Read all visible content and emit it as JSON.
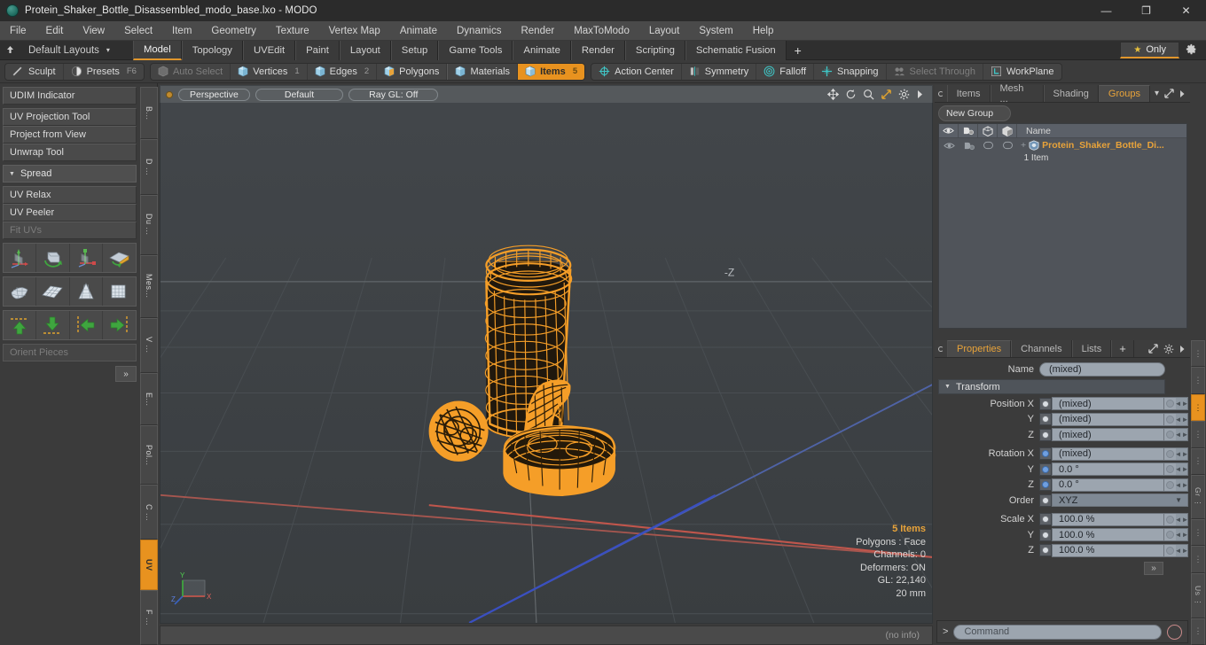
{
  "window": {
    "title": "Protein_Shaker_Bottle_Disassembled_modo_base.lxo - MODO",
    "minimize": "—",
    "maximize": "❐",
    "close": "✕"
  },
  "menubar": [
    "File",
    "Edit",
    "View",
    "Select",
    "Item",
    "Geometry",
    "Texture",
    "Vertex Map",
    "Animate",
    "Dynamics",
    "Render",
    "MaxToModo",
    "Layout",
    "System",
    "Help"
  ],
  "layoutbar": {
    "default_layouts": "Default Layouts",
    "caret": "▾",
    "tabs": [
      {
        "label": "Model",
        "active": true
      },
      {
        "label": "Topology",
        "active": false
      },
      {
        "label": "UVEdit",
        "active": false
      },
      {
        "label": "Paint",
        "active": false
      },
      {
        "label": "Layout",
        "active": false
      },
      {
        "label": "Setup",
        "active": false
      },
      {
        "label": "Game Tools",
        "active": false
      },
      {
        "label": "Animate",
        "active": false
      },
      {
        "label": "Render",
        "active": false
      },
      {
        "label": "Scripting",
        "active": false
      },
      {
        "label": "Schematic Fusion",
        "active": false
      }
    ],
    "plus": "+",
    "only": "Only",
    "accent": "#e0962c"
  },
  "modebar": {
    "left_group": [
      {
        "label": "Sculpt",
        "icon": "sculpt-icon",
        "shortcut": ""
      },
      {
        "label": "Presets",
        "icon": "presets-icon",
        "shortcut": "F6"
      }
    ],
    "select_group": [
      {
        "label": "Auto Select",
        "count": "",
        "state": "dim"
      },
      {
        "label": "Vertices",
        "count": "1",
        "state": "normal"
      },
      {
        "label": "Edges",
        "count": "2",
        "state": "normal"
      },
      {
        "label": "Polygons",
        "count": "",
        "state": "normal"
      },
      {
        "label": "Materials",
        "count": "",
        "state": "normal"
      },
      {
        "label": "Items",
        "count": "5",
        "state": "selected"
      }
    ],
    "tool_group": [
      {
        "label": "Action Center",
        "state": "normal"
      },
      {
        "label": "Symmetry",
        "state": "normal"
      },
      {
        "label": "Falloff",
        "state": "normal"
      },
      {
        "label": "Snapping",
        "state": "normal"
      },
      {
        "label": "Select Through",
        "state": "dim"
      },
      {
        "label": "WorkPlane",
        "state": "normal"
      }
    ]
  },
  "left_panel": {
    "buttons_top": [
      "UDIM Indicator"
    ],
    "buttons_group2": [
      "UV Projection Tool",
      "Project from View",
      "Unwrap Tool"
    ],
    "section": {
      "label": "Spread",
      "tri": "▼"
    },
    "buttons_group3": [
      {
        "label": "UV Relax",
        "dim": false
      },
      {
        "label": "UV Peeler",
        "dim": false
      },
      {
        "label": "Fit UVs",
        "dim": true
      }
    ],
    "icon_rows": [
      [
        "move-axis-icon",
        "rotate-cube-icon",
        "scale-axis-icon",
        "flatten-icon"
      ],
      [
        "sphere-uv-icon",
        "grid-uv-icon",
        "cone-uv-icon",
        "box-uv-icon"
      ],
      [
        "align-up-icon",
        "align-down-icon",
        "align-left-icon",
        "align-right-icon"
      ]
    ],
    "orient_pieces": "Orient Pieces",
    "expand": "»",
    "vtabs": [
      {
        "label": "B...",
        "on": false
      },
      {
        "label": "D ...",
        "on": false
      },
      {
        "label": "Du ...",
        "on": false
      },
      {
        "label": "Mes...",
        "on": false
      },
      {
        "label": "V ...",
        "on": false
      },
      {
        "label": "E...",
        "on": false
      },
      {
        "label": "Pol...",
        "on": false
      },
      {
        "label": "C ...",
        "on": false
      },
      {
        "label": "UV",
        "on": true
      },
      {
        "label": "F ...",
        "on": false
      }
    ]
  },
  "viewport": {
    "header": {
      "perspective": "Perspective",
      "shading": "Default",
      "raygl": "Ray GL: Off",
      "icons": [
        "pan-icon",
        "rotate-icon",
        "zoom-icon",
        "fit-icon",
        "gear-icon",
        "chevron-right-icon"
      ]
    },
    "axis_label_minus_z": "-Z",
    "stats": {
      "items": "5 Items",
      "polygons": "Polygons : Face",
      "channels": "Channels: 0",
      "deformers": "Deformers: ON",
      "gl": "GL: 22,140",
      "scale": "20 mm"
    },
    "axis_gizmo": {
      "x": "X",
      "y": "Y",
      "z": "Z"
    },
    "model_color": "#f59e28",
    "bg_color": "#3e4245"
  },
  "info_bar": {
    "text": "(no info)"
  },
  "right_panel": {
    "top_tabs": [
      {
        "label": "Items",
        "active": false
      },
      {
        "label": "Mesh ...",
        "active": false
      },
      {
        "label": "Shading",
        "active": false
      },
      {
        "label": "Groups",
        "active": true
      }
    ],
    "top_tabs_caret": "▾",
    "new_group": "New Group",
    "list_header": {
      "col_icons": [
        "eye-icon",
        "render-icon",
        "wire-icon",
        "shade-icon"
      ],
      "name": "Name"
    },
    "list_rows": [
      {
        "name": "Protein_Shaker_Bottle_Di...",
        "sub": "1 Item",
        "plus": "+"
      }
    ],
    "prop_tabs": [
      {
        "label": "Properties",
        "active": true
      },
      {
        "label": "Channels",
        "active": false
      },
      {
        "label": "Lists",
        "active": false
      },
      {
        "label": "+",
        "active": false
      }
    ],
    "properties": {
      "name_label": "Name",
      "name_value": "(mixed)",
      "transform_label": "Transform",
      "transform_tri": "▼",
      "rows": [
        {
          "label": "Position X",
          "value": "(mixed)",
          "dot": "white"
        },
        {
          "label": "Y",
          "value": "(mixed)",
          "dot": "white"
        },
        {
          "label": "Z",
          "value": "(mixed)",
          "dot": "white"
        },
        {
          "label": "Rotation X",
          "value": "(mixed)",
          "dot": "blue"
        },
        {
          "label": "Y",
          "value": "0.0 °",
          "dot": "blue"
        },
        {
          "label": "Z",
          "value": "0.0 °",
          "dot": "blue"
        }
      ],
      "order_label": "Order",
      "order_value": "XYZ",
      "scale_rows": [
        {
          "label": "Scale X",
          "value": "100.0 %",
          "dot": "white"
        },
        {
          "label": "Y",
          "value": "100.0 %",
          "dot": "white"
        },
        {
          "label": "Z",
          "value": "100.0 %",
          "dot": "white"
        }
      ],
      "expand": "»"
    },
    "command": {
      "prompt": ">",
      "placeholder": "Command",
      "record": "record-icon"
    },
    "vtabs": [
      {
        "label": "⋮",
        "on": false
      },
      {
        "label": "⋮",
        "on": false
      },
      {
        "label": "⋮",
        "on": true
      },
      {
        "label": "⋮",
        "on": false
      },
      {
        "label": "⋮",
        "on": false
      },
      {
        "label": "Gr ⋮",
        "on": false
      },
      {
        "label": "⋮",
        "on": false
      },
      {
        "label": "⋮",
        "on": false
      },
      {
        "label": "Us ⋮",
        "on": false
      },
      {
        "label": "⋮",
        "on": false
      }
    ]
  }
}
